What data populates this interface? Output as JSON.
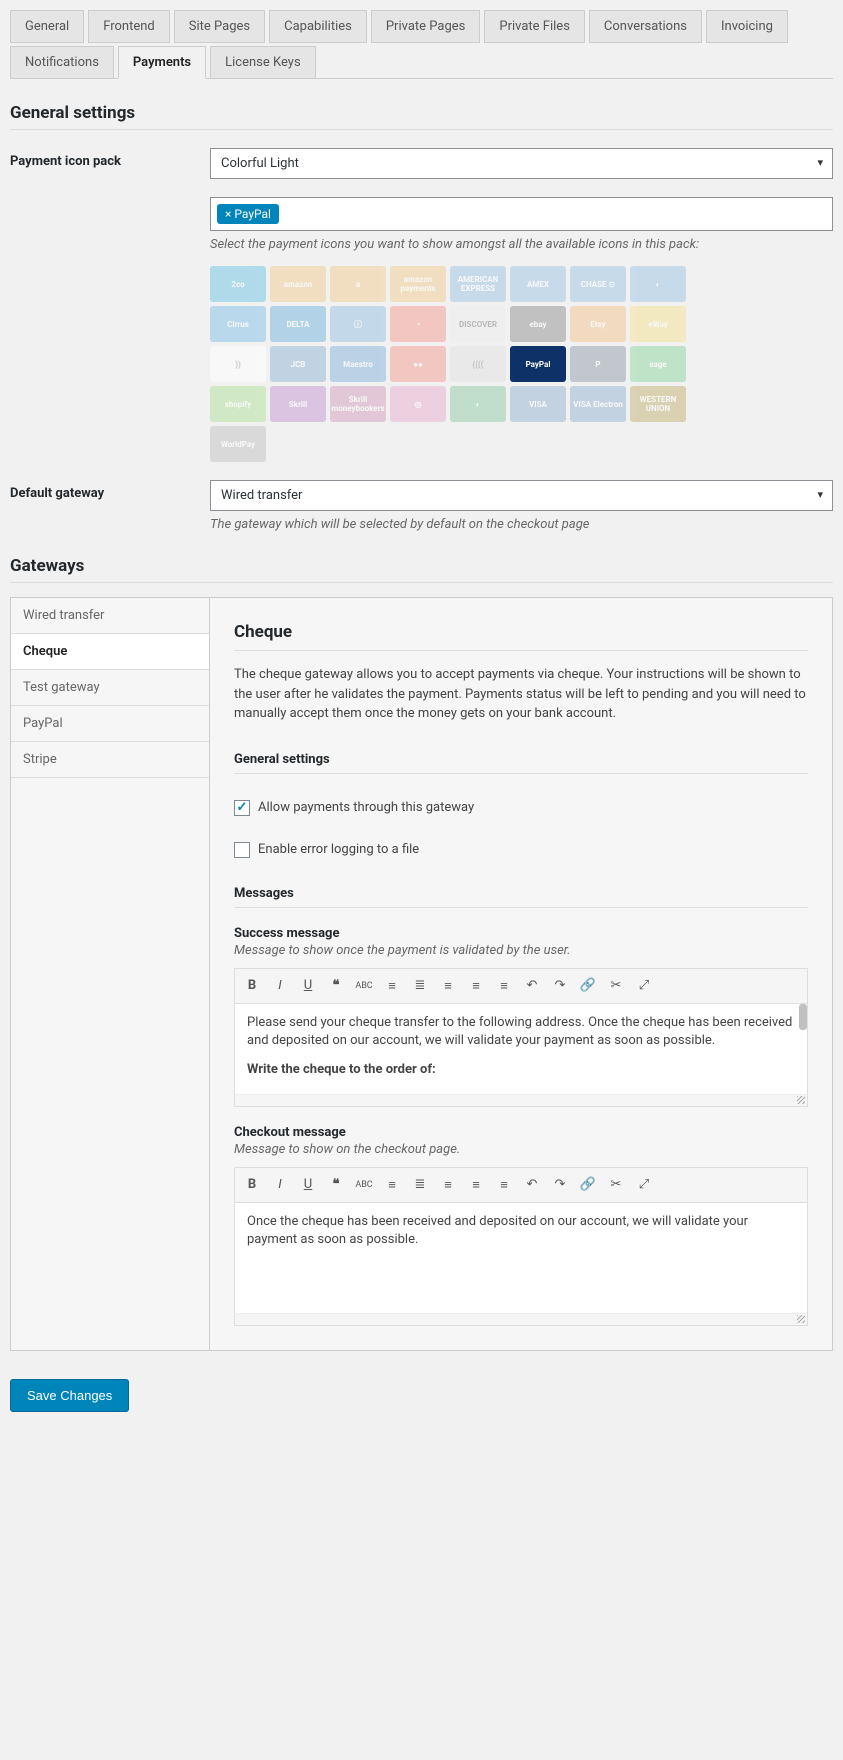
{
  "tabs": [
    "General",
    "Frontend",
    "Site Pages",
    "Capabilities",
    "Private Pages",
    "Private Files",
    "Conversations",
    "Invoicing",
    "Notifications",
    "Payments",
    "License Keys"
  ],
  "active_tab": "Payments",
  "sections": {
    "general_title": "General settings",
    "icon_pack_label": "Payment icon pack",
    "icon_pack_value": "Colorful Light",
    "selected_tag": "× PayPal",
    "icon_help": "Select the payment icons you want to show amongst all the available icons in this pack:",
    "default_gw_label": "Default gateway",
    "default_gw_value": "Wired transfer",
    "default_gw_help": "The gateway which will be selected by default on the checkout page",
    "gateways_title": "Gateways"
  },
  "payment_icons": [
    {
      "name": "2co",
      "bg": "#79c8e6"
    },
    {
      "name": "amazon",
      "bg": "#f2cf99"
    },
    {
      "name": "a",
      "bg": "#f2cf99"
    },
    {
      "name": "amazon payments",
      "bg": "#f2cf99"
    },
    {
      "name": "AMERICAN EXPRESS",
      "bg": "#a5c9e5"
    },
    {
      "name": "AMEX",
      "bg": "#a5c9e5"
    },
    {
      "name": "CHASE ⊙",
      "bg": "#a5c9e5"
    },
    {
      "name": "◐",
      "bg": "#a5c9e5"
    },
    {
      "name": "Cirrus",
      "bg": "#8ec4e8"
    },
    {
      "name": "DELTA",
      "bg": "#7fbce0"
    },
    {
      "name": "ⓘ",
      "bg": "#9ec5e3"
    },
    {
      "name": "◔",
      "bg": "#f3a59a"
    },
    {
      "name": "DISCOVER",
      "bg": "#eee",
      "tc": "#888"
    },
    {
      "name": "ebay",
      "bg": "#9a9a9a"
    },
    {
      "name": "Etsy",
      "bg": "#f4c89b"
    },
    {
      "name": "eWay",
      "bg": "#f4e39a"
    },
    {
      "name": "))",
      "bg": "#fff",
      "tc": "#aaa"
    },
    {
      "name": "JCB",
      "bg": "#9bbbd9"
    },
    {
      "name": "Maestro",
      "bg": "#8fb8dc"
    },
    {
      "name": "●●",
      "bg": "#f3a59a"
    },
    {
      "name": "((((",
      "bg": "#e3e3e3",
      "tc": "#999"
    },
    {
      "name": "PayPal",
      "bg": "#0d3268",
      "sel": true
    },
    {
      "name": "P",
      "bg": "#9aa6b0"
    },
    {
      "name": "sage",
      "bg": "#95d8a4"
    },
    {
      "name": "shopify",
      "bg": "#b6e29f"
    },
    {
      "name": "Skrill",
      "bg": "#c9a0d6"
    },
    {
      "name": "Skrill moneybookers",
      "bg": "#d6a5c1"
    },
    {
      "name": "◎",
      "bg": "#e8b6d3"
    },
    {
      "name": "◐",
      "bg": "#9bd0b0"
    },
    {
      "name": "VISA",
      "bg": "#9cb9d5"
    },
    {
      "name": "VISA Electron",
      "bg": "#9cb9d5"
    },
    {
      "name": "WESTERN UNION",
      "bg": "#c7b87d"
    },
    {
      "name": "WorldPay",
      "bg": "#c7c7c7"
    }
  ],
  "gateways_nav": [
    "Wired transfer",
    "Cheque",
    "Test gateway",
    "PayPal",
    "Stripe"
  ],
  "gateway_active": "Cheque",
  "cheque": {
    "title": "Cheque",
    "desc": "The cheque gateway allows you to accept payments via cheque. Your instructions will be shown to the user after he validates the payment. Payments status will be left to pending and you will need to manually accept them once the money gets on your bank account.",
    "general_h": "General settings",
    "allow_label": "Allow payments through this gateway",
    "allow_checked": true,
    "error_log_label": "Enable error logging to a file",
    "error_log_checked": false,
    "messages_h": "Messages",
    "success_label": "Success message",
    "success_help": "Message to show once the payment is validated by the user.",
    "success_body": "Please send your cheque transfer to the following address. Once the cheque has been received and deposited on our account, we will validate your payment as soon as possible.",
    "success_bold": "Write the cheque to the order of:",
    "checkout_label": "Checkout message",
    "checkout_help": "Message to show on the checkout page.",
    "checkout_body": "Once the cheque has been received and deposited on our account, we will validate your payment as soon as possible."
  },
  "save_label": "Save Changes"
}
